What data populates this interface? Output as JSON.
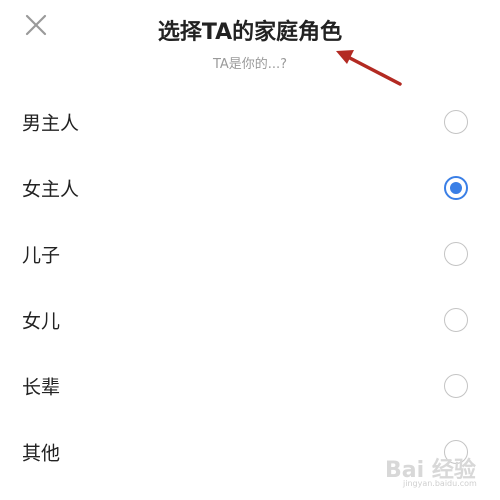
{
  "dialog": {
    "title": "选择TA的家庭角色",
    "subtitle": "TA是你的...?",
    "close_icon": "close-icon"
  },
  "accent_color": "#3a7fe6",
  "annotation": {
    "icon": "red-arrow-pointing-to-title",
    "color": "#b32a22"
  },
  "options": [
    {
      "label": "男主人",
      "selected": false
    },
    {
      "label": "女主人",
      "selected": true
    },
    {
      "label": "儿子",
      "selected": false
    },
    {
      "label": "女儿",
      "selected": false
    },
    {
      "label": "长辈",
      "selected": false
    },
    {
      "label": "其他",
      "selected": false
    }
  ],
  "watermark": {
    "logo": "Bai 经验",
    "url": "jingyan.baidu.com"
  }
}
